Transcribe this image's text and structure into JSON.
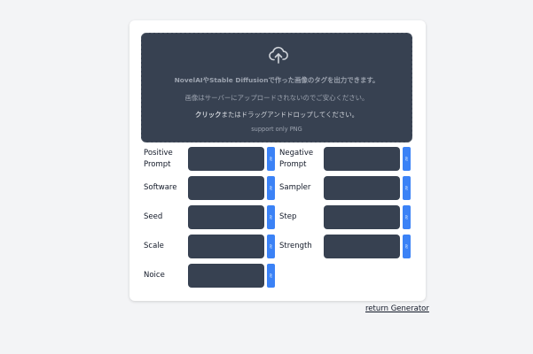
{
  "dropzone": {
    "line1": "NovelAIやStable Diffusionで作った画像のタグを出力できます。",
    "line2": "画像はサーバーにアップロードされないのでご安心ください。",
    "line3_bold": "クリック",
    "line3_rest": "またはドラッグアンドドロップしてください。",
    "line4": "support only PNG",
    "icon": "cloud-upload-icon"
  },
  "fields": {
    "positive_prompt": {
      "label": "Positive Prompt",
      "value": ""
    },
    "negative_prompt": {
      "label": "Negative Prompt",
      "value": ""
    },
    "software": {
      "label": "Software",
      "value": ""
    },
    "sampler": {
      "label": "Sampler",
      "value": ""
    },
    "seed": {
      "label": "Seed",
      "value": ""
    },
    "step": {
      "label": "Step",
      "value": ""
    },
    "scale": {
      "label": "Scale",
      "value": ""
    },
    "strength": {
      "label": "Strength",
      "value": ""
    },
    "noice": {
      "label": "Noice",
      "value": ""
    }
  },
  "copy_button_glyph": "⎘",
  "footer": {
    "return_label": "return Generator"
  },
  "colors": {
    "page_bg": "#f3f4f6",
    "card_bg": "#ffffff",
    "dark_panel": "#374151",
    "accent": "#3b82f6"
  }
}
